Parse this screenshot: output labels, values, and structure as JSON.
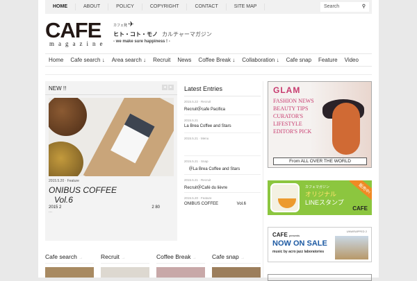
{
  "topnav": {
    "items": [
      "HOME",
      "ABOUT",
      "POLICY",
      "COPYRIGHT",
      "CONTACT",
      "SITE MAP"
    ],
    "search_placeholder": "Search"
  },
  "logo": {
    "text": "CAFE",
    "sub": "magazine",
    "small": "カフェ発",
    "tagline_jp": "ヒト・コト・モノ",
    "tagline_jp2": "カルチャーマガジン",
    "tagline_en": "- we make sure happiness ! -"
  },
  "mainnav": [
    "Home",
    "Cafe search ↓",
    "Area search ↓",
    "Recruit",
    "News",
    "Coffee Break ↓",
    "Collaboration ↓",
    "Cafe snap",
    "Feature",
    "Video"
  ],
  "new": {
    "heading": "NEW !!",
    "meta": "2015.5.20 · Feature",
    "title1": "ONIBUS COFFEE",
    "title2": "Vol.6",
    "excerpt": "2015  2",
    "excerpt_right": "2   80",
    "more": "..."
  },
  "latest": {
    "heading": "Latest Entries",
    "entries": [
      {
        "meta": "2015.5.22 · Recruit",
        "title": "Recruit＠cafe Pacifica"
      },
      {
        "meta": "2015.5.21",
        "title": "La Brea Coffee and Stars"
      },
      {
        "meta": "2015.5.21 · Menu",
        "title": ""
      },
      {
        "meta": "2015.5.21 · Snap",
        "title": "    ＠La Brea Coffee and Stars"
      },
      {
        "meta": "2015.5.21 · Recruit",
        "title": "Recruit＠Café du lièvre"
      },
      {
        "meta": "2015.5.20 · Feature",
        "title": "ONIBUS COFFEE                Vol.6"
      }
    ]
  },
  "ads": {
    "glam": {
      "brand": "GLAM",
      "lines": [
        "FASHION NEWS",
        "BEAUTY TIPS",
        "CURATOR'S",
        "LIFESTYLE",
        "EDITOR'S PICK"
      ],
      "footer": "From ALL OVER THE WORLD"
    },
    "line": {
      "small": "カフェマガジン",
      "l1": "オリジナル",
      "l2": "LINEスタンプ",
      "badge": "販売中!",
      "logo": "CAFE"
    },
    "now": {
      "logo": "CAFE",
      "presents": "presents",
      "title": "NOW ON SALE",
      "music": "music by acro jazz laboratories",
      "album": "UNWRAPPED 2"
    }
  },
  "categories": [
    "Cafe search",
    "Recruit",
    "Coffee Break",
    "Cafe snap"
  ]
}
